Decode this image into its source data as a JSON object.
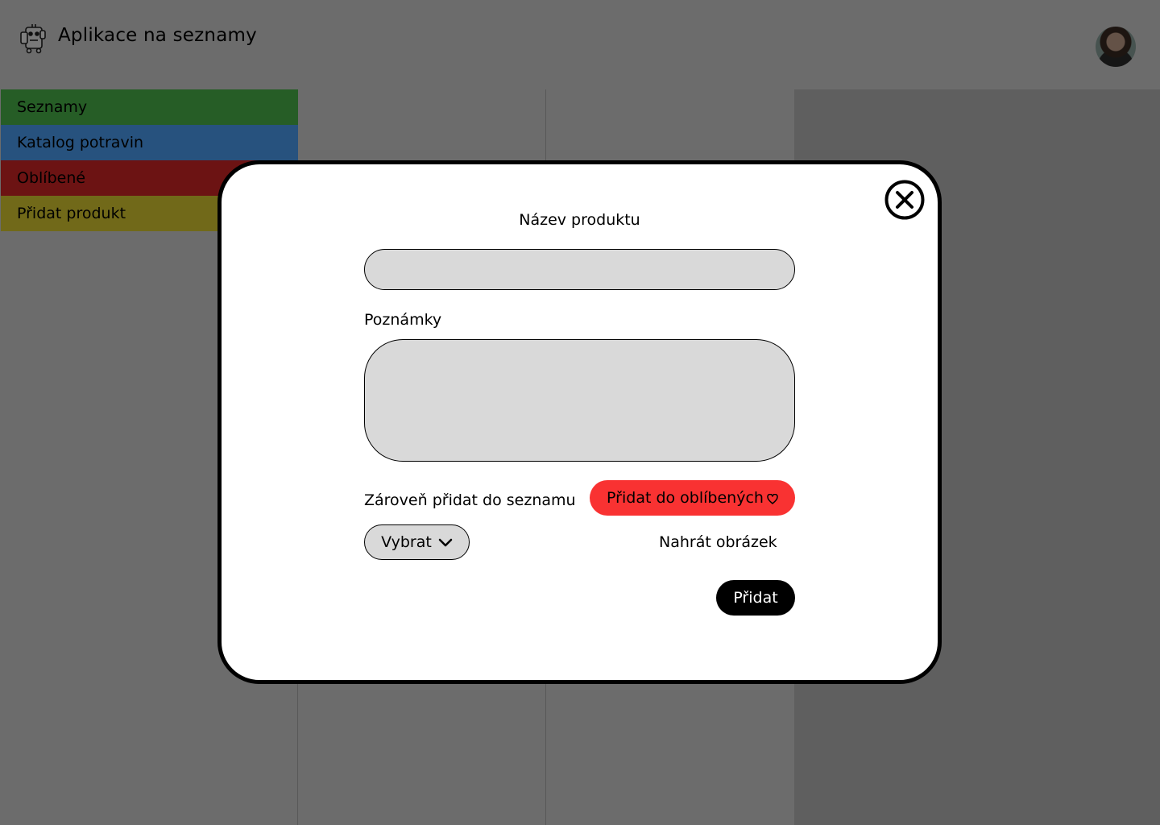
{
  "app": {
    "title": "Aplikace na seznamy"
  },
  "sidebar": {
    "items": [
      {
        "label": "Seznamy",
        "color": "#4cbb4c"
      },
      {
        "label": "Katalog potravin",
        "color": "#4ea5fc"
      },
      {
        "label": "Oblíbené",
        "color": "#d92626"
      },
      {
        "label": "Přidat produkt",
        "color": "#e3d233"
      }
    ]
  },
  "modal": {
    "name_label": "Název produktu",
    "name_value": "",
    "notes_label": "Poznámky",
    "notes_value": "",
    "add_to_list_label": "Zároveň přidat do seznamu",
    "favorite_button": "Přidat do oblíbených",
    "select_button": "Vybrat",
    "upload_link": "Nahrát obrázek",
    "submit_button": "Přidat"
  },
  "colors": {
    "overlay": "rgba(0,0,0,0.5)",
    "favorite": "#f93232",
    "input_bg": "#d9d9d9"
  },
  "icons": {
    "logo": "shopping-robot-icon",
    "close": "close-circle-icon",
    "favorite": "heart-outline-icon",
    "dropdown": "chevron-down-icon"
  }
}
